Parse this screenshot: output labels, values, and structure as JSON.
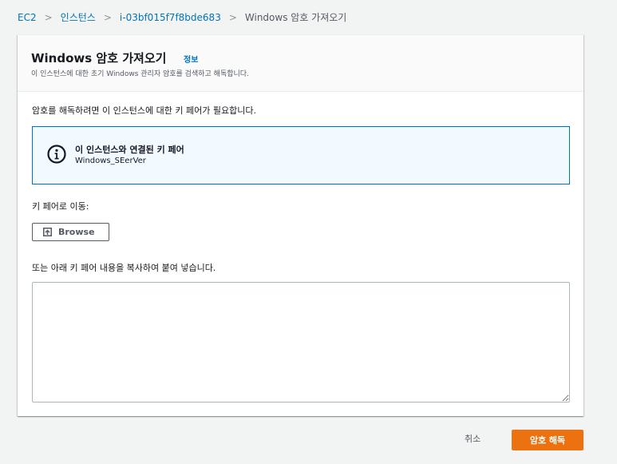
{
  "breadcrumb": {
    "items": [
      "EC2",
      "인스턴스",
      "i-03bf015f7f8bde683"
    ],
    "current": "Windows 암호 가져오기",
    "separator": ">"
  },
  "panel": {
    "title": "Windows 암호 가져오기",
    "info_link": "정보",
    "description": "이 인스턴스에 대한 초기 Windows 관리자 암호를 검색하고 해독합니다."
  },
  "intro_text": "암호를 해독하려면 이 인스턴스에 대한 키 페어가 필요합니다.",
  "info_box": {
    "icon": "info-icon",
    "title": "이 인스턴스와 연결된 키 페어",
    "value": "Windows_SEerVer"
  },
  "move_label": "키 페어로 이동:",
  "browse_button": {
    "label": "Browse",
    "icon": "upload-icon"
  },
  "paste_label": "또는 아래 키 페어 내용을 복사하여 붙여 넣습니다.",
  "textarea": {
    "value": "",
    "placeholder": ""
  },
  "footer": {
    "cancel_label": "취소",
    "decrypt_label": "암호 해독"
  },
  "colors": {
    "link": "#0073bb",
    "primary_button": "#ec7211",
    "info_box_bg": "#f1faff",
    "info_box_border": "#0073bb",
    "page_bg": "#f2f3f3"
  }
}
